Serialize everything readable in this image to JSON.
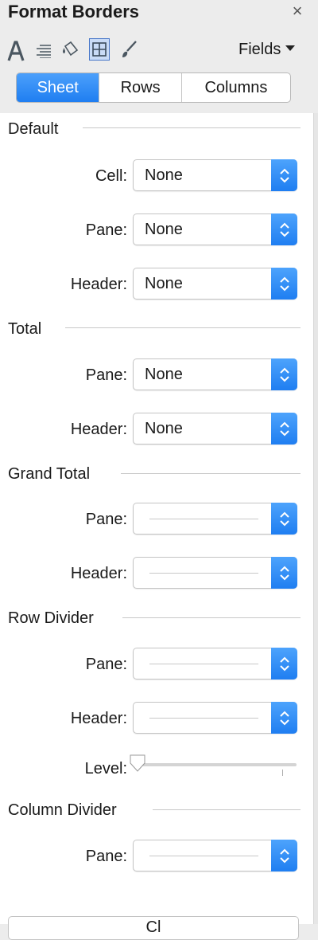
{
  "window": {
    "title": "Format Borders",
    "close_glyph": "×"
  },
  "toolbar": {
    "icons": [
      "font-icon",
      "alignment-icon",
      "shading-icon",
      "borders-icon",
      "lines-icon"
    ],
    "selected": "borders-icon",
    "fields_label": "Fields"
  },
  "tabs": [
    "Sheet",
    "Rows",
    "Columns"
  ],
  "active_tab": "Sheet",
  "sections": {
    "default": {
      "title": "Default",
      "cell": {
        "label": "Cell:",
        "value": "None"
      },
      "pane": {
        "label": "Pane:",
        "value": "None"
      },
      "header": {
        "label": "Header:",
        "value": "None"
      }
    },
    "total": {
      "title": "Total",
      "pane": {
        "label": "Pane:",
        "value": "None"
      },
      "header": {
        "label": "Header:",
        "value": "None"
      }
    },
    "grand_total": {
      "title": "Grand Total",
      "pane": {
        "label": "Pane:",
        "value": "line"
      },
      "header": {
        "label": "Header:",
        "value": "line"
      }
    },
    "row_divider": {
      "title": "Row Divider",
      "pane": {
        "label": "Pane:",
        "value": "line"
      },
      "header": {
        "label": "Header:",
        "value": "line"
      },
      "level": {
        "label": "Level:",
        "value": 0
      }
    },
    "column_divider": {
      "title": "Column Divider",
      "pane": {
        "label": "Pane:",
        "value": "line"
      }
    }
  },
  "bottom_button": {
    "label": "Cl"
  },
  "colors": {
    "accent": "#1f7ef1",
    "selected_icon_bg": "#c9dbf6"
  }
}
